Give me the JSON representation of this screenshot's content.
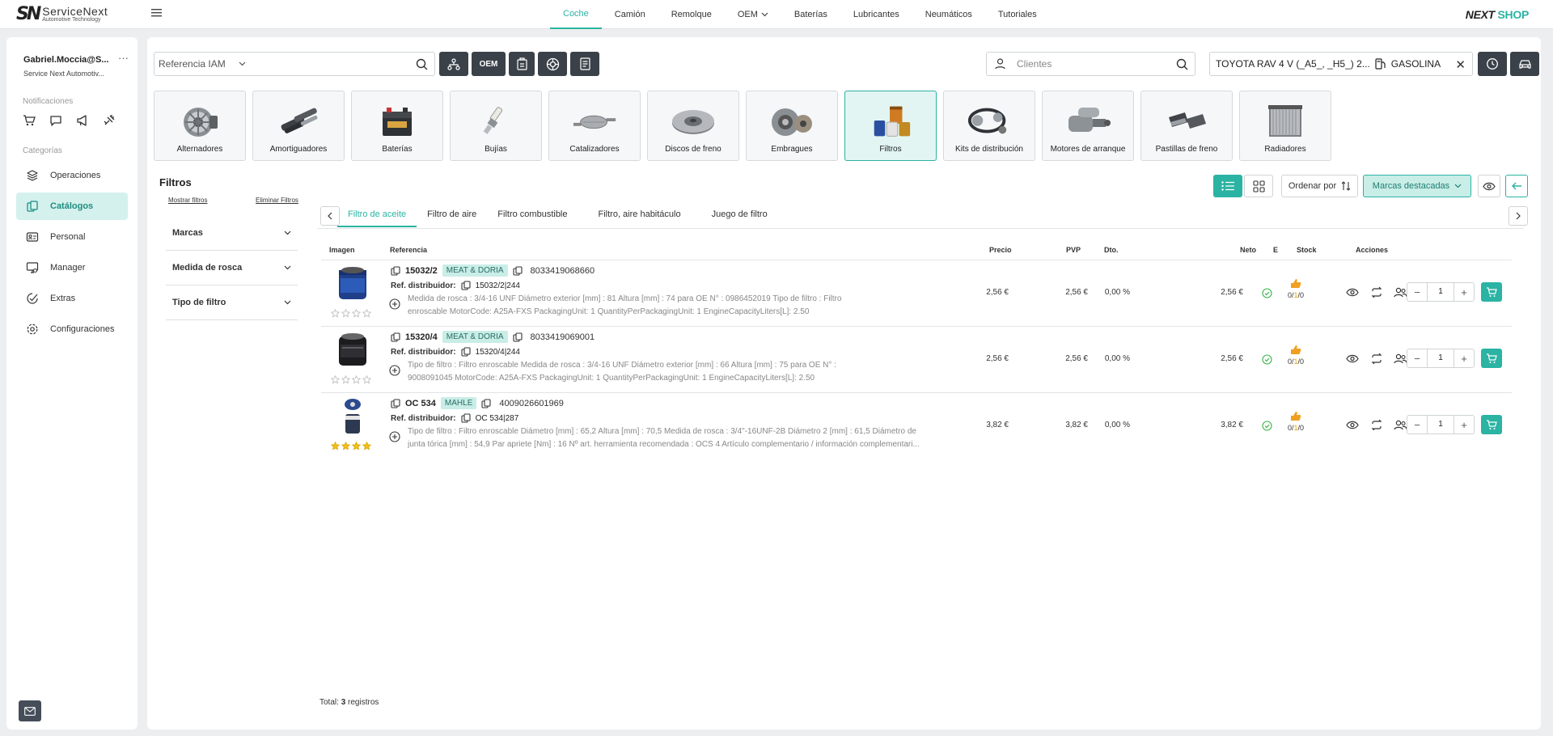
{
  "brand": {
    "logo_mark": "SN",
    "name": "ServiceNext",
    "tagline": "Automotive Technology"
  },
  "shop_logo": {
    "part1": "NEXT",
    "part2": "SHOP"
  },
  "nav": [
    {
      "label": "Coche",
      "active": true
    },
    {
      "label": "Camión"
    },
    {
      "label": "Remolque"
    },
    {
      "label": "OEM",
      "dropdown": true
    },
    {
      "label": "Baterías"
    },
    {
      "label": "Lubricantes"
    },
    {
      "label": "Neumáticos"
    },
    {
      "label": "Tutoriales"
    }
  ],
  "sidebar": {
    "user": "Gabriel.Moccia@S...",
    "user_menu": "···",
    "company": "Service Next Automotiv...",
    "notifications_heading": "Notificaciones",
    "notification_icons": [
      "cart-icon",
      "chat-icon",
      "megaphone-icon",
      "satellite-icon"
    ],
    "categories_heading": "Categorías",
    "items": [
      {
        "label": "Operaciones",
        "icon": "layers-icon"
      },
      {
        "label": "Catálogos",
        "icon": "catalog-icon",
        "active": true
      },
      {
        "label": "Personal",
        "icon": "id-card-icon"
      },
      {
        "label": "Manager",
        "icon": "monitor-user-icon"
      },
      {
        "label": "Extras",
        "icon": "badge-check-icon"
      },
      {
        "label": "Configuraciones",
        "icon": "gear-icon"
      }
    ]
  },
  "search": {
    "reference_label": "Referencia IAM",
    "oem_label": "OEM",
    "clients_placeholder": "Clientes"
  },
  "vehicle": {
    "name": "TOYOTA RAV 4 V (_A5_, _H5_) 2...",
    "fuel": "GASOLINA"
  },
  "categories": [
    {
      "label": "Alternadores"
    },
    {
      "label": "Amortiguadores"
    },
    {
      "label": "Baterías"
    },
    {
      "label": "Bujías"
    },
    {
      "label": "Catalizadores"
    },
    {
      "label": "Discos de freno"
    },
    {
      "label": "Embragues"
    },
    {
      "label": "Filtros",
      "active": true
    },
    {
      "label": "Kits de distribución"
    },
    {
      "label": "Motores de arranque"
    },
    {
      "label": "Pastillas de freno"
    },
    {
      "label": "Radiadores"
    }
  ],
  "section": {
    "title": "Filtros",
    "sort_label": "Ordenar por",
    "brands_label": "Marcas destacadas",
    "show_filters": "Mostrar filtros",
    "clear_filters": "Eliminar Filtros",
    "filter_groups": [
      "Marcas",
      "Medida de rosca",
      "Tipo de filtro"
    ]
  },
  "subtabs": [
    {
      "label": "Filtro de aceite",
      "active": true
    },
    {
      "label": "Filtro de aire"
    },
    {
      "label": "Filtro combustible"
    },
    {
      "label": "Filtro, aire habitáculo"
    },
    {
      "label": "Juego de filtro"
    }
  ],
  "table": {
    "columns": [
      "Imagen",
      "Referencia",
      "Precio",
      "PVP",
      "Dto.",
      "Neto",
      "E",
      "Stock",
      "Acciones"
    ],
    "dist_label": "Ref. distribuidor:",
    "rows": [
      {
        "code": "15032/2",
        "brand": "MEAT & DORIA",
        "ean": "8033419068660",
        "dist_ref": "15032/2|244",
        "desc1": "Medida de rosca : 3/4-16 UNF Diámetro exterior [mm] : 81 Altura [mm] : 74 para OE N° : 0986452019 Tipo de filtro : Filtro",
        "desc2": "enroscable MotorCode: A25A-FXS  PackagingUnit: 1  QuantityPerPackagingUnit: 1  EngineCapacityLiters[L]: 2.50",
        "price": "2,56 €",
        "pvp": "2,56 €",
        "dto": "0,00 %",
        "neto": "2,56 €",
        "stock_a": "0",
        "stock_b": "1",
        "stock_c": "0",
        "qty": "1",
        "rating": 0
      },
      {
        "code": "15320/4",
        "brand": "MEAT & DORIA",
        "ean": "8033419069001",
        "dist_ref": "15320/4|244",
        "desc1": "Tipo de filtro : Filtro enroscable Medida de rosca : 3/4-16 UNF Diámetro exterior [mm] : 66 Altura [mm] : 75 para OE N° :",
        "desc2": "9008091045 MotorCode: A25A-FXS  PackagingUnit: 1  QuantityPerPackagingUnit: 1  EngineCapacityLiters[L]: 2.50",
        "price": "2,56 €",
        "pvp": "2,56 €",
        "dto": "0,00 %",
        "neto": "2,56 €",
        "stock_a": "0",
        "stock_b": "1",
        "stock_c": "0",
        "qty": "1",
        "rating": 0
      },
      {
        "code": "OC 534",
        "brand": "MAHLE",
        "ean": "4009026601969",
        "dist_ref": "OC 534|287",
        "desc1": "Tipo de filtro : Filtro enroscable Diámetro [mm] : 65,2 Altura [mm] : 70,5 Medida de rosca : 3/4\"-16UNF-2B Diámetro 2 [mm] : 61,5 Diámetro de",
        "desc2": "junta tórica [mm] : 54,9 Par apriete [Nm] : 16 Nº art. herramienta recomendada : OCS 4 Artículo complementario / información complementari...",
        "price": "3,82 €",
        "pvp": "3,82 €",
        "dto": "0,00 %",
        "neto": "3,82 €",
        "stock_a": "0",
        "stock_b": "1",
        "stock_c": "0",
        "qty": "1",
        "rating": 4
      }
    ]
  },
  "total": {
    "label": "Total:",
    "count": "3",
    "suffix": "registros"
  },
  "colors": {
    "accent": "#2bb3a3",
    "accent_light": "#c9ede7",
    "dark_button": "#3b4149"
  }
}
